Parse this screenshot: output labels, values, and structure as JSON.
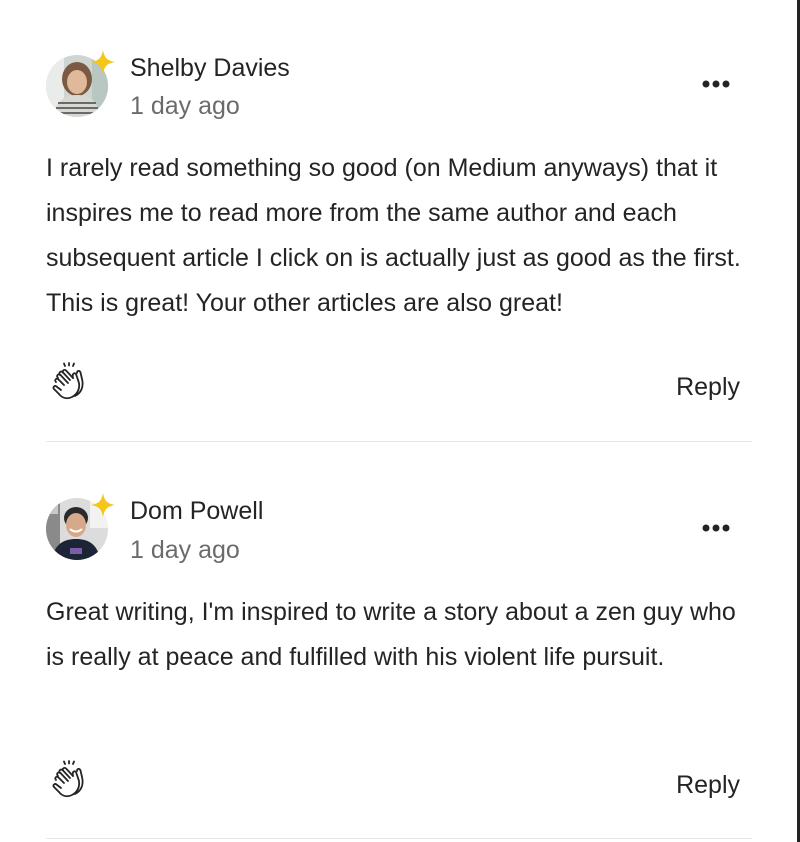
{
  "responses": [
    {
      "author": "Shelby Davies",
      "time": "1 day ago",
      "text": "I rarely read something so good (on Medium anyways) that it inspires me to read more from the same author and each subsequent article I click on is actually just as good as the first. This is great! Your other articles are also great!",
      "reply_label": "Reply",
      "avatar_icon": "profile-photo",
      "badge_icon": "star-badge-icon",
      "clap_icon": "clap-icon",
      "more_icon": "more-dots-icon"
    },
    {
      "author": "Dom Powell",
      "time": "1 day ago",
      "text": "Great writing, I'm inspired to write a story about a zen guy who is really at peace and fulfilled with his violent life pursuit.",
      "reply_label": "Reply",
      "avatar_icon": "profile-photo",
      "badge_icon": "star-badge-icon",
      "clap_icon": "clap-icon",
      "more_icon": "more-dots-icon"
    }
  ],
  "colors": {
    "text": "#242424",
    "muted": "#6b6b6b",
    "star": "#f5c518",
    "divider": "#e8e8e8"
  }
}
